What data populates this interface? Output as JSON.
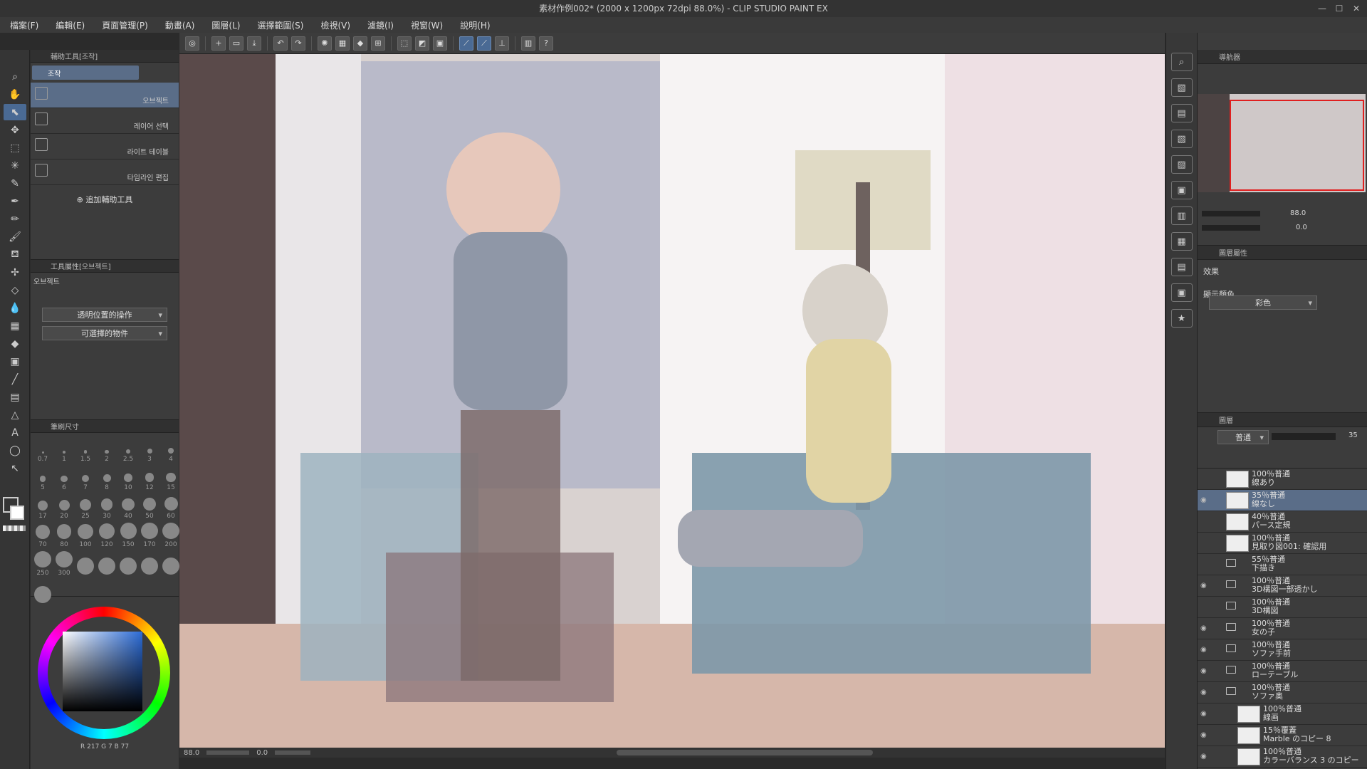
{
  "window": {
    "title": "素材作例002* (2000 x 1200px 72dpi 88.0%) - CLIP STUDIO PAINT EX",
    "minimize": "—",
    "maximize": "☐",
    "close": "✕"
  },
  "menu": [
    "檔案(F)",
    "編輯(E)",
    "頁面管理(P)",
    "動畫(A)",
    "圖層(L)",
    "選擇範圍(S)",
    "檢視(V)",
    "濾鏡(I)",
    "視窗(W)",
    "說明(H)"
  ],
  "sub_tool": {
    "header": "輔助工具[조작]",
    "tab_label": "조작",
    "items": [
      {
        "label": "오브젝트",
        "selected": true
      },
      {
        "label": "레이어 선택",
        "selected": false
      },
      {
        "label": "라이트 테이블",
        "selected": false
      },
      {
        "label": "타임라인 편집",
        "selected": false
      }
    ],
    "add_label": "追加輔助工具"
  },
  "tool_property": {
    "header": "工具屬性[오브젝트]",
    "name": "오브젝트",
    "dropdown1": "透明位置的操作",
    "dropdown2": "可選擇的物件"
  },
  "brush_size": {
    "header": "筆刷尺寸",
    "sizes": [
      "0.7",
      "1",
      "1.5",
      "2",
      "2.5",
      "3",
      "4",
      "5",
      "6",
      "7",
      "8",
      "10",
      "12",
      "15",
      "17",
      "20",
      "25",
      "30",
      "40",
      "50",
      "60",
      "70",
      "80",
      "100",
      "120",
      "150",
      "170",
      "200",
      "250",
      "300",
      "",
      "",
      "",
      "",
      "",
      ""
    ]
  },
  "color": {
    "readout": "R 217  G 7  B 77",
    "main_color": "#ffffff",
    "sub_color": "#5c7fa8",
    "picker_base": "#2b6bd6"
  },
  "status": {
    "zoom": "88.0",
    "angle": "0.0"
  },
  "navigator": {
    "tab": "導航器",
    "zoom": "88.0",
    "rotation": "0.0"
  },
  "layer_property": {
    "tab": "圖層屬性",
    "effect_label": "效果",
    "display_color_label": "顯示顏色",
    "display_color_value": "彩色"
  },
  "layer_panel": {
    "tab": "圖層",
    "blend_mode": "普通",
    "opacity": "35",
    "layers": [
      {
        "opacity": "100％普通",
        "name": "線あり",
        "type": "thumb",
        "visible": false,
        "selected": false,
        "indent": 0
      },
      {
        "opacity": "35％普通",
        "name": "線なし",
        "type": "thumb",
        "visible": true,
        "selected": true,
        "indent": 0
      },
      {
        "opacity": "40％普通",
        "name": "パース定規",
        "type": "thumb",
        "visible": false,
        "selected": false,
        "indent": 0
      },
      {
        "opacity": "100％普通",
        "name": "見取り図001: 確認用",
        "type": "thumb",
        "visible": false,
        "selected": false,
        "indent": 0
      },
      {
        "opacity": "55％普通",
        "name": "下描き",
        "type": "folder",
        "visible": false,
        "selected": false,
        "indent": 0
      },
      {
        "opacity": "100％普通",
        "name": "3D構図一部透かし",
        "type": "folder",
        "visible": true,
        "selected": false,
        "indent": 0
      },
      {
        "opacity": "100％普通",
        "name": "3D構図",
        "type": "folder",
        "visible": false,
        "selected": false,
        "indent": 0
      },
      {
        "opacity": "100％普通",
        "name": "女の子",
        "type": "folder",
        "visible": true,
        "selected": false,
        "indent": 0
      },
      {
        "opacity": "100％普通",
        "name": "ソファ手前",
        "type": "folder",
        "visible": true,
        "selected": false,
        "indent": 0
      },
      {
        "opacity": "100％普通",
        "name": "ローテーブル",
        "type": "folder",
        "visible": true,
        "selected": false,
        "indent": 0
      },
      {
        "opacity": "100％普通",
        "name": "ソファ奥",
        "type": "folder",
        "visible": true,
        "selected": false,
        "indent": 0
      },
      {
        "opacity": "100％普通",
        "name": "線画",
        "type": "thumb",
        "visible": true,
        "selected": false,
        "indent": 1
      },
      {
        "opacity": "15％覆蓋",
        "name": "Marble のコピー 8",
        "type": "thumb",
        "visible": true,
        "selected": false,
        "indent": 1
      },
      {
        "opacity": "100％普通",
        "name": "カラーバランス 3 のコピー",
        "type": "thumb",
        "visible": true,
        "selected": false,
        "indent": 1
      }
    ]
  }
}
